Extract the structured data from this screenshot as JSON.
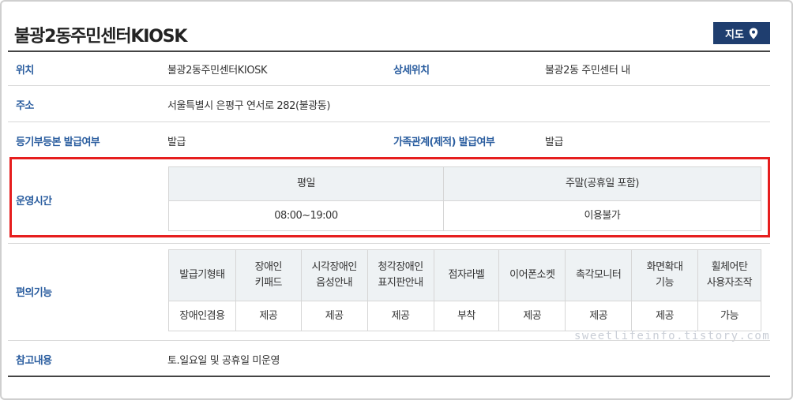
{
  "header": {
    "title": "불광2동주민센터KIOSK",
    "map_button_label": "지도",
    "map_icon": "map-pin-icon"
  },
  "info": {
    "location_label": "위치",
    "location_value": "불광2동주민센터KIOSK",
    "detail_location_label": "상세위치",
    "detail_location_value": "불광2동 주민센터 내",
    "address_label": "주소",
    "address_value": "서울특별시 은평구 연서로 282(불광동)",
    "registry_label": "등기부등본 발급여부",
    "registry_value": "발급",
    "family_label": "가족관계(제적) 발급여부",
    "family_value": "발급",
    "hours_label": "운영시간",
    "features_label": "편의기능",
    "notes_label": "참고내용",
    "notes_value": "토.일요일 및 공휴일 미운영"
  },
  "hours": {
    "headers": [
      "평일",
      "주말(공휴일 포함)"
    ],
    "values": [
      "08:00~19:00",
      "이용불가"
    ]
  },
  "features": {
    "headers": [
      [
        "발급기형태"
      ],
      [
        "장애인",
        "키패드"
      ],
      [
        "시각장애인",
        "음성안내"
      ],
      [
        "청각장애인",
        "표지판안내"
      ],
      [
        "점자라벨"
      ],
      [
        "이어폰소켓"
      ],
      [
        "촉각모니터"
      ],
      [
        "화면확대",
        "기능"
      ],
      [
        "휠체어탄",
        "사용자조작"
      ]
    ],
    "values": [
      "장애인겸용",
      "제공",
      "제공",
      "제공",
      "부착",
      "제공",
      "제공",
      "제공",
      "가능"
    ]
  },
  "colors": {
    "label_blue": "#2a5d9f",
    "button_navy": "#1f3e6f",
    "highlight_red": "#e61e1e",
    "header_bg": "#eef2f4"
  },
  "watermark": "sweetlifeinfo.tistory.com"
}
